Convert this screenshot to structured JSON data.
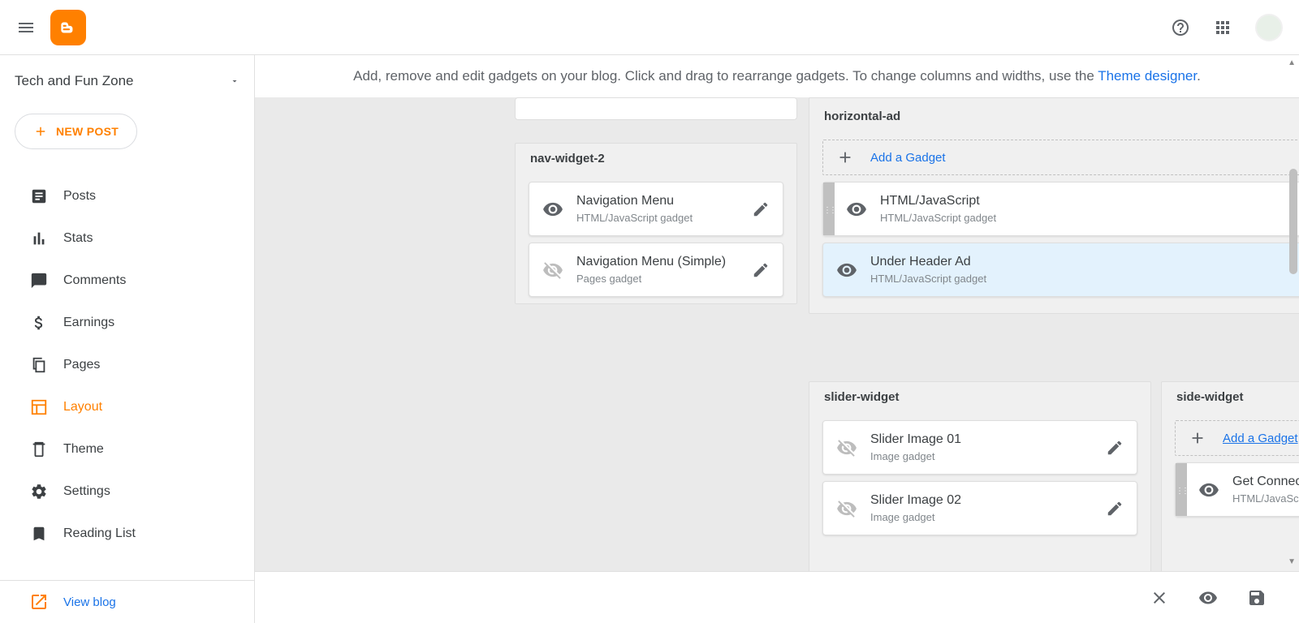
{
  "header": {
    "blog_name": "Tech and Fun Zone",
    "new_post": "NEW POST"
  },
  "nav": [
    {
      "label": "Posts",
      "icon": "posts"
    },
    {
      "label": "Stats",
      "icon": "stats"
    },
    {
      "label": "Comments",
      "icon": "comments"
    },
    {
      "label": "Earnings",
      "icon": "earnings"
    },
    {
      "label": "Pages",
      "icon": "pages"
    },
    {
      "label": "Layout",
      "icon": "layout",
      "active": true
    },
    {
      "label": "Theme",
      "icon": "theme"
    },
    {
      "label": "Settings",
      "icon": "settings"
    },
    {
      "label": "Reading List",
      "icon": "reading"
    }
  ],
  "view_blog": "View blog",
  "helper": {
    "text_before": "Add, remove and edit gadgets on your blog. Click and drag to rearrange gadgets. To change columns and widths, use the ",
    "link": "Theme designer",
    "text_after": "."
  },
  "sections": {
    "nav_widget_2": {
      "title": "nav-widget-2",
      "gadgets": [
        {
          "title": "Navigation Menu",
          "subtitle": "HTML/JavaScript gadget",
          "visible": true
        },
        {
          "title": "Navigation Menu (Simple)",
          "subtitle": "Pages gadget",
          "visible": false
        }
      ]
    },
    "horizontal_ad": {
      "title": "horizontal-ad",
      "add_label": "Add a Gadget",
      "gadgets": [
        {
          "title": "HTML/JavaScript",
          "subtitle": "HTML/JavaScript gadget",
          "visible": true,
          "handle": true
        },
        {
          "title": "Under Header Ad",
          "subtitle": "HTML/JavaScript gadget",
          "visible": true,
          "selected": true
        }
      ]
    },
    "slider_widget": {
      "title": "slider-widget",
      "gadgets": [
        {
          "title": "Slider Image 01",
          "subtitle": "Image gadget",
          "visible": false
        },
        {
          "title": "Slider Image 02",
          "subtitle": "Image gadget",
          "visible": false
        }
      ]
    },
    "side_widget": {
      "title": "side-widget",
      "add_label": "Add a Gadget",
      "gadgets": [
        {
          "title": "Get Connected",
          "subtitle": "HTML/JavaScript gadget",
          "visible": true,
          "handle": true
        }
      ]
    }
  }
}
